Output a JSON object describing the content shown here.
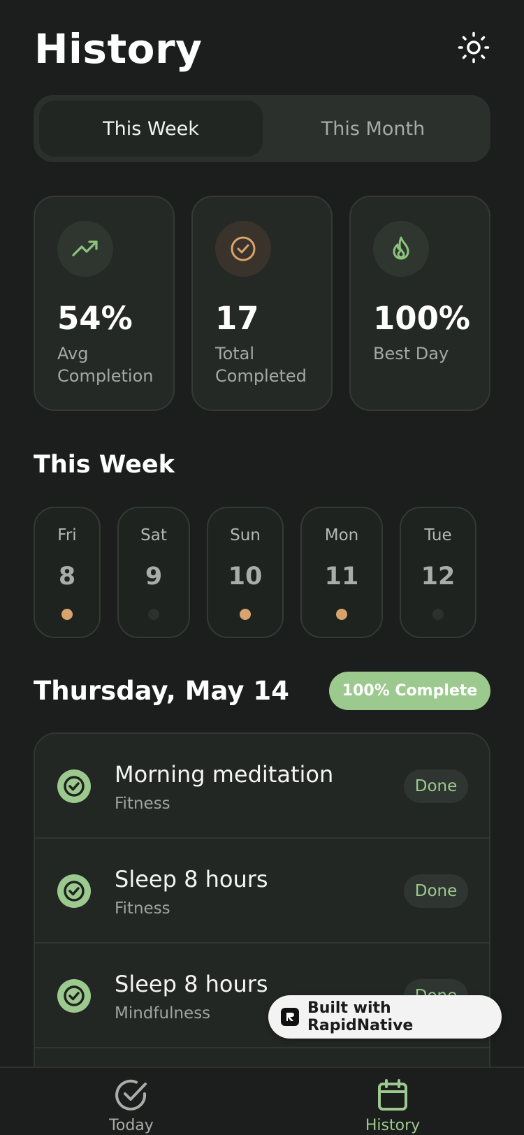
{
  "header": {
    "title": "History"
  },
  "tabs": [
    {
      "label": "This Week",
      "active": true
    },
    {
      "label": "This Month",
      "active": false
    }
  ],
  "stats": [
    {
      "value": "54%",
      "label": "Avg Completion",
      "icon": "trending-up-icon",
      "color": "#8bc47c"
    },
    {
      "value": "17",
      "label": "Total Completed",
      "icon": "check-circle-icon",
      "color": "#d9a36e"
    },
    {
      "value": "100%",
      "label": "Best Day",
      "icon": "flame-icon",
      "color": "#8bc47c"
    }
  ],
  "week": {
    "title": "This Week",
    "days": [
      {
        "name": "Fri",
        "num": "8",
        "status_color": "#d9a36e"
      },
      {
        "name": "Sat",
        "num": "9",
        "status_color": "#2d312e"
      },
      {
        "name": "Sun",
        "num": "10",
        "status_color": "#d9a36e"
      },
      {
        "name": "Mon",
        "num": "11",
        "status_color": "#d9a36e"
      },
      {
        "name": "Tue",
        "num": "12",
        "status_color": "#2d312e"
      }
    ]
  },
  "selected_day": {
    "title": "Thursday, May 14",
    "badge": "100% Complete",
    "tasks": [
      {
        "name": "Morning meditation",
        "category": "Fitness",
        "status": "Done"
      },
      {
        "name": "Sleep 8 hours",
        "category": "Fitness",
        "status": "Done"
      },
      {
        "name": "Sleep 8 hours",
        "category": "Mindfulness",
        "status": "Done"
      }
    ]
  },
  "built_with": {
    "label": "Built with RapidNative"
  },
  "nav": [
    {
      "label": "Today",
      "icon": "check-circle-icon",
      "active": false
    },
    {
      "label": "History",
      "icon": "calendar-icon",
      "active": true
    }
  ],
  "colors": {
    "accent": "#9cc98e",
    "warm": "#d9a36e",
    "background": "#1b1e1c"
  }
}
